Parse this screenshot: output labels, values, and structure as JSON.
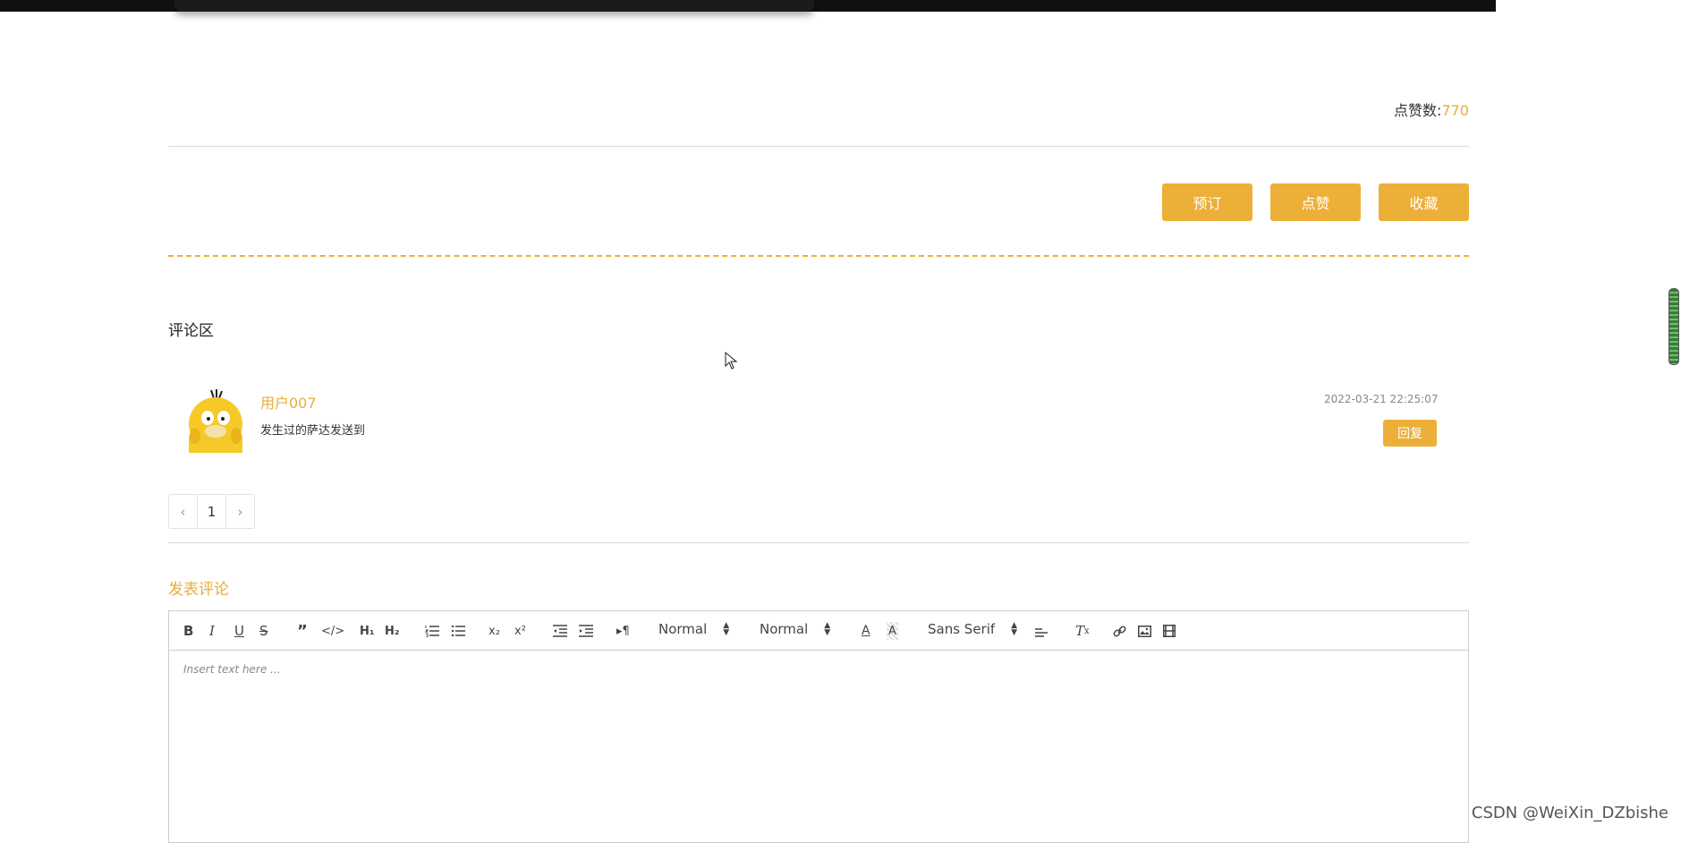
{
  "stats": {
    "like_label": "点赞数:",
    "like_count": "770"
  },
  "actions": {
    "book": "预订",
    "like": "点赞",
    "favorite": "收藏"
  },
  "comments": {
    "section_title": "评论区",
    "items": [
      {
        "user": "用户007",
        "text": "发生过的萨达发送到",
        "time": "2022-03-21 22:25:07",
        "reply_label": "回复"
      }
    ]
  },
  "pagination": {
    "prev": "‹",
    "current": "1",
    "next": "›"
  },
  "post": {
    "title": "发表评论",
    "placeholder": "Insert text here ...",
    "toolbar": {
      "header_select": "Normal",
      "size_select": "Normal",
      "font_select": "Sans Serif"
    }
  },
  "watermark": "CSDN @WeiXin_DZbishe",
  "colors": {
    "accent": "#ecaf38",
    "accent_text": "#e8ad3a"
  }
}
